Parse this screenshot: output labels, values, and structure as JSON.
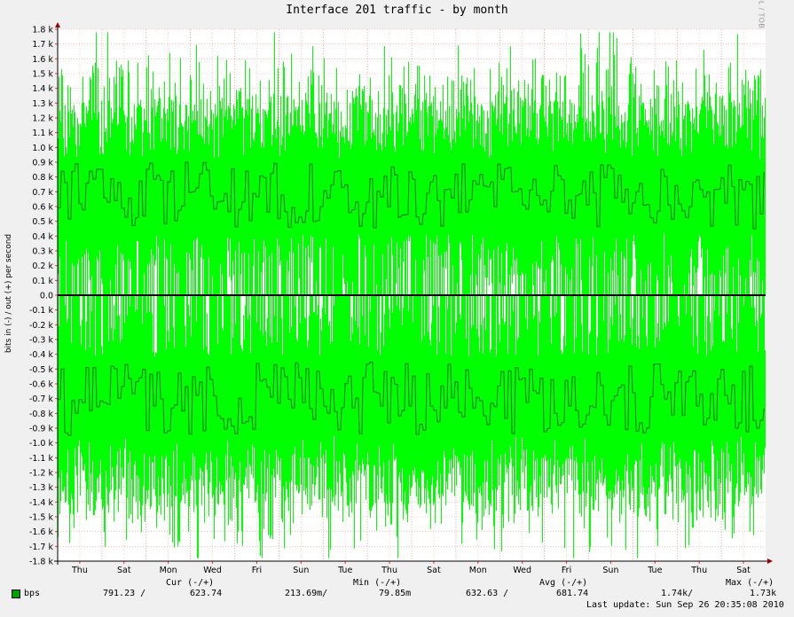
{
  "chart_data": {
    "type": "area",
    "title": "Interface 201 traffic - by month",
    "ylabel": "bits in (-) / out (+) per second",
    "ylim": [
      -1800,
      1800
    ],
    "yticks": [
      {
        "v": 1800,
        "label": "1.8 k"
      },
      {
        "v": 1700,
        "label": "1.7 k"
      },
      {
        "v": 1600,
        "label": "1.6 k"
      },
      {
        "v": 1500,
        "label": "1.5 k"
      },
      {
        "v": 1400,
        "label": "1.4 k"
      },
      {
        "v": 1300,
        "label": "1.3 k"
      },
      {
        "v": 1200,
        "label": "1.2 k"
      },
      {
        "v": 1100,
        "label": "1.1 k"
      },
      {
        "v": 1000,
        "label": "1.0 k"
      },
      {
        "v": 900,
        "label": "0.9 k"
      },
      {
        "v": 800,
        "label": "0.8 k"
      },
      {
        "v": 700,
        "label": "0.7 k"
      },
      {
        "v": 600,
        "label": "0.6 k"
      },
      {
        "v": 500,
        "label": "0.5 k"
      },
      {
        "v": 400,
        "label": "0.4 k"
      },
      {
        "v": 300,
        "label": "0.3 k"
      },
      {
        "v": 200,
        "label": "0.2 k"
      },
      {
        "v": 100,
        "label": "0.1 k"
      },
      {
        "v": 0,
        "label": "0.0"
      },
      {
        "v": -100,
        "label": "-0.1 k"
      },
      {
        "v": -200,
        "label": "-0.2 k"
      },
      {
        "v": -300,
        "label": "-0.3 k"
      },
      {
        "v": -400,
        "label": "-0.4 k"
      },
      {
        "v": -500,
        "label": "-0.5 k"
      },
      {
        "v": -600,
        "label": "-0.6 k"
      },
      {
        "v": -700,
        "label": "-0.7 k"
      },
      {
        "v": -800,
        "label": "-0.8 k"
      },
      {
        "v": -900,
        "label": "-0.9 k"
      },
      {
        "v": -1000,
        "label": "-1.0 k"
      },
      {
        "v": -1100,
        "label": "-1.1 k"
      },
      {
        "v": -1200,
        "label": "-1.2 k"
      },
      {
        "v": -1300,
        "label": "-1.3 k"
      },
      {
        "v": -1400,
        "label": "-1.4 k"
      },
      {
        "v": -1500,
        "label": "-1.5 k"
      },
      {
        "v": -1600,
        "label": "-1.6 k"
      },
      {
        "v": -1700,
        "label": "-1.7 k"
      },
      {
        "v": -1800,
        "label": "-1.8 k"
      }
    ],
    "xticks": [
      "Thu",
      "Sat",
      "Mon",
      "Wed",
      "Fri",
      "Sun",
      "Tue",
      "Thu",
      "Sat",
      "Mon",
      "Wed",
      "Fri",
      "Sun",
      "Tue",
      "Thu",
      "Sat"
    ],
    "grid": true,
    "series": [
      {
        "name": "bps",
        "color": "#00ff00",
        "avg_color": "#007000"
      }
    ],
    "noise_seed": 201
  },
  "watermark": "RRDTOOL / TOBI OETIKER",
  "legend": {
    "headers": {
      "cur": "Cur (-/+)",
      "min": "Min (-/+)",
      "avg": "Avg (-/+)",
      "max": "Max (-/+)"
    },
    "row": {
      "name": "bps",
      "cur_in": "791.23 /",
      "cur_out": "623.74",
      "min_in": "213.69m/",
      "min_out": "79.85m",
      "avg_in": "632.63 /",
      "avg_out": "681.74",
      "max_in": "1.74k/",
      "max_out": "1.73k"
    },
    "swatch_color": "#00a000"
  },
  "last_update": "Last update: Sun Sep 26 20:35:08 2010"
}
